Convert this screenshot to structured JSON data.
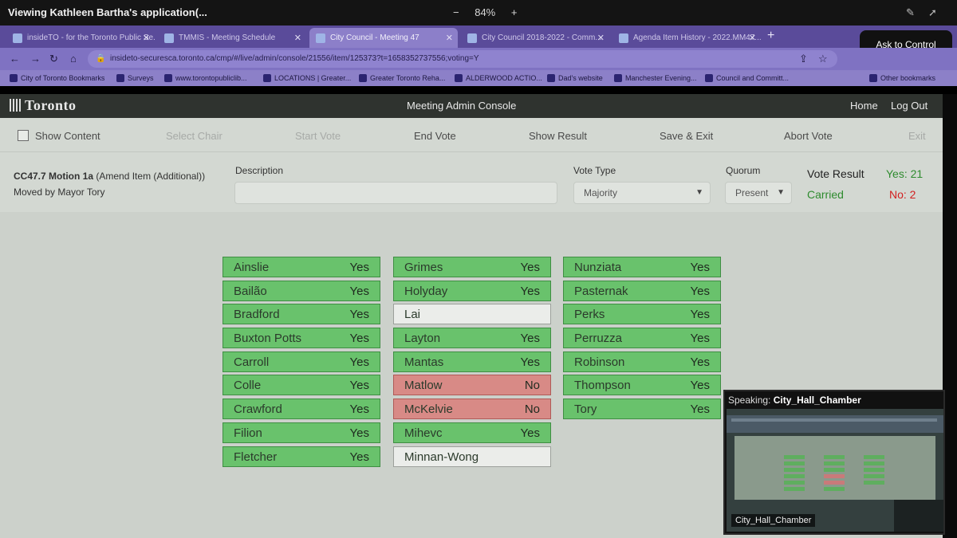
{
  "zoom_bar": {
    "title": "Viewing Kathleen Bartha's application(...",
    "minus": "−",
    "zoom": "84%",
    "plus": "+",
    "ask_to_control": "Ask to Control"
  },
  "tabs": [
    {
      "label": "insideTO - for the Toronto Public Se..."
    },
    {
      "label": "TMMIS - Meeting Schedule"
    },
    {
      "label": "City Council - Meeting 47"
    },
    {
      "label": "City Council 2018-2022 - Comm..."
    },
    {
      "label": "Agenda Item History - 2022.MM47..."
    }
  ],
  "address": {
    "url": "insideto-securesca.toronto.ca/cmp/#/live/admin/console/21556/item/125373?t=1658352737556;voting=Y"
  },
  "bookmarks": [
    "City of Toronto Bookmarks",
    "Surveys",
    "www.torontopubliclib...",
    "LOCATIONS | Greater...",
    "Greater Toronto Reha...",
    "ALDERWOOD ACTIO...",
    "Dad's website",
    "Manchester Evening...",
    "Council and Committ...",
    "Other bookmarks"
  ],
  "header": {
    "logo": "Toronto",
    "title": "Meeting Admin Console",
    "home": "Home",
    "logout": "Log Out"
  },
  "toolbar": {
    "show_content": "Show Content",
    "select_chair": "Select Chair",
    "start_vote": "Start Vote",
    "end_vote": "End Vote",
    "show_result": "Show Result",
    "save_exit": "Save & Exit",
    "abort_vote": "Abort Vote",
    "exit": "Exit"
  },
  "motion": {
    "id": "CC47.7 Motion 1a",
    "type": "(Amend Item (Additional))",
    "mover": "Moved by Mayor Tory",
    "description_label": "Description",
    "description_value": "",
    "vote_type_label": "Vote Type",
    "vote_type_value": "Majority",
    "quorum_label": "Quorum",
    "quorum_value": "Present",
    "vote_result_label": "Vote Result",
    "result": "Carried",
    "yes": "Yes: 21",
    "no": "No: 2"
  },
  "colors": {
    "yes": "#69c26c",
    "no": "#d88a86",
    "none": "#ebedea",
    "carried": "#2e8b2e",
    "no_text": "#d21f1f"
  },
  "members": [
    [
      {
        "name": "Ainslie",
        "vote": "Yes"
      },
      {
        "name": "Bailão",
        "vote": "Yes"
      },
      {
        "name": "Bradford",
        "vote": "Yes"
      },
      {
        "name": "Buxton Potts",
        "vote": "Yes"
      },
      {
        "name": "Carroll",
        "vote": "Yes"
      },
      {
        "name": "Colle",
        "vote": "Yes"
      },
      {
        "name": "Crawford",
        "vote": "Yes"
      },
      {
        "name": "Filion",
        "vote": "Yes"
      },
      {
        "name": "Fletcher",
        "vote": "Yes"
      }
    ],
    [
      {
        "name": "Grimes",
        "vote": "Yes"
      },
      {
        "name": "Holyday",
        "vote": "Yes"
      },
      {
        "name": "Lai",
        "vote": ""
      },
      {
        "name": "Layton",
        "vote": "Yes"
      },
      {
        "name": "Mantas",
        "vote": "Yes"
      },
      {
        "name": "Matlow",
        "vote": "No"
      },
      {
        "name": "McKelvie",
        "vote": "No"
      },
      {
        "name": "Mihevc",
        "vote": "Yes"
      },
      {
        "name": "Minnan-Wong",
        "vote": ""
      }
    ],
    [
      {
        "name": "Nunziata",
        "vote": "Yes"
      },
      {
        "name": "Pasternak",
        "vote": "Yes"
      },
      {
        "name": "Perks",
        "vote": "Yes"
      },
      {
        "name": "Perruzza",
        "vote": "Yes"
      },
      {
        "name": "Robinson",
        "vote": "Yes"
      },
      {
        "name": "Thompson",
        "vote": "Yes"
      },
      {
        "name": "Tory",
        "vote": "Yes"
      }
    ]
  ],
  "speaking": {
    "label": "Speaking:",
    "name": "City_Hall_Chamber",
    "video_tag": "City_Hall_Chamber"
  }
}
